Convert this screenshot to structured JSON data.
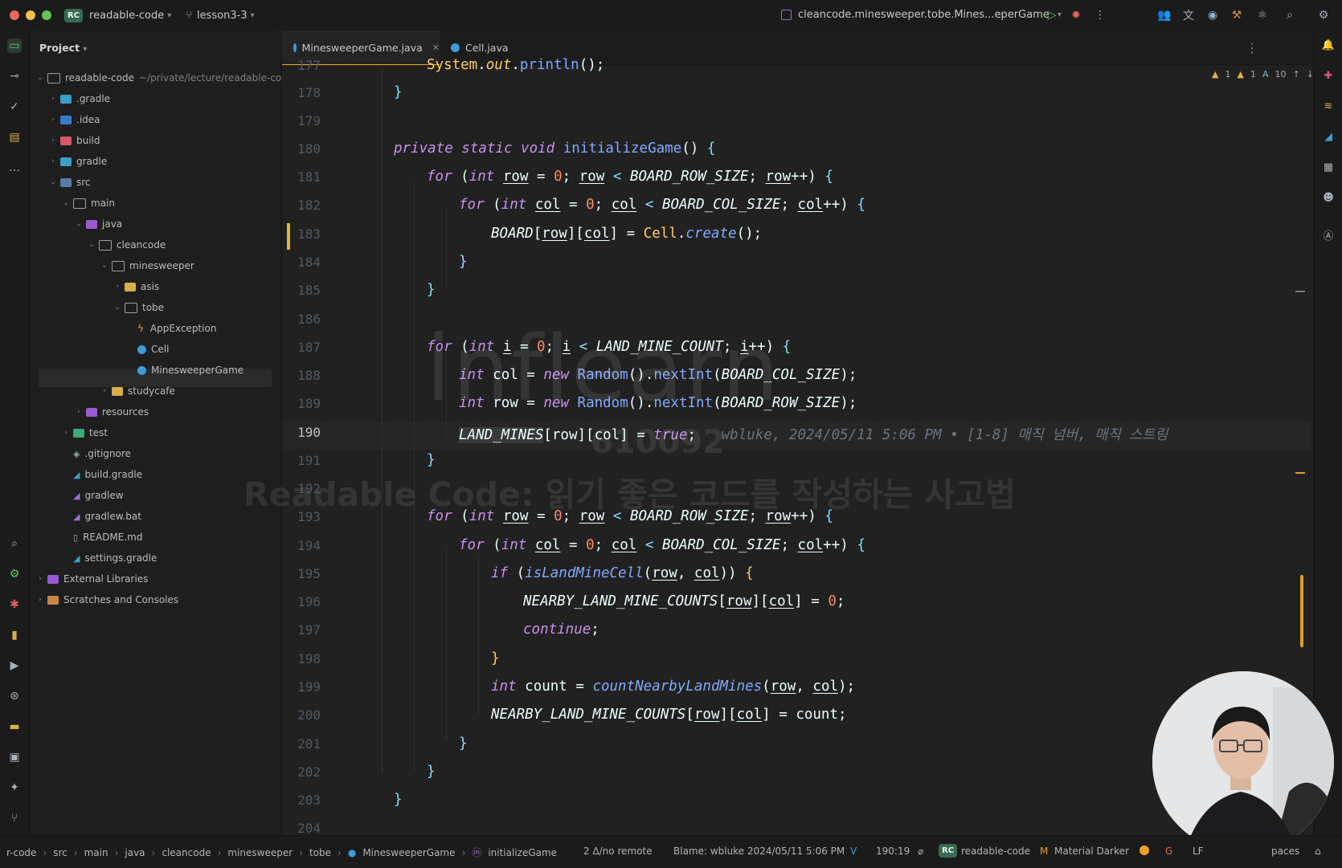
{
  "titlebar": {
    "project_badge": "RC",
    "project_name": "readable-code",
    "branch": "lesson3-3",
    "run_config": "cleancode.minesweeper.tobe.Mines...eperGame"
  },
  "project_panel": {
    "header": "Project",
    "tree": [
      {
        "label": "readable-code",
        "sub": "~/private/lecture/readable-co"
      },
      {
        "label": ".gradle"
      },
      {
        "label": ".idea"
      },
      {
        "label": "build"
      },
      {
        "label": "gradle"
      },
      {
        "label": "src"
      },
      {
        "label": "main"
      },
      {
        "label": "java"
      },
      {
        "label": "cleancode"
      },
      {
        "label": "minesweeper"
      },
      {
        "label": "asis"
      },
      {
        "label": "tobe"
      },
      {
        "label": "AppException"
      },
      {
        "label": "Cell"
      },
      {
        "label": "MinesweeperGame"
      },
      {
        "label": "studycafe"
      },
      {
        "label": "resources"
      },
      {
        "label": "test"
      },
      {
        "label": ".gitignore"
      },
      {
        "label": "build.gradle"
      },
      {
        "label": "gradlew"
      },
      {
        "label": "gradlew.bat"
      },
      {
        "label": "README.md"
      },
      {
        "label": "settings.gradle"
      },
      {
        "label": "External Libraries"
      },
      {
        "label": "Scratches and Consoles"
      }
    ]
  },
  "tabs": [
    {
      "label": "MinesweeperGame.java",
      "active": true
    },
    {
      "label": "Cell.java",
      "active": false
    }
  ],
  "inspections": {
    "warnings_a": "1",
    "warnings_b": "1",
    "typos": "10"
  },
  "editor": {
    "line_numbers": [
      "177",
      "178",
      "179",
      "180",
      "181",
      "182",
      "183",
      "184",
      "185",
      "186",
      "187",
      "188",
      "189",
      "190",
      "191",
      "192",
      "193",
      "194",
      "195",
      "196",
      "197",
      "198",
      "199",
      "200",
      "201",
      "202",
      "203",
      "204"
    ],
    "current_line": "190",
    "blame_inline": "wbluke, 2024/05/11 5:06 PM • [1-8] 매직 넘버, 매직 스트링",
    "top_partial": "System.out.println();"
  },
  "watermark": {
    "brand": "inflearn",
    "id": "610092",
    "course": "Readable Code: 읽기 좋은 코드를 작성하는 사고법"
  },
  "statusbar": {
    "breadcrumbs": [
      "r-code",
      "src",
      "main",
      "java",
      "cleancode",
      "minesweeper",
      "tobe",
      "MinesweeperGame",
      "initializeGame"
    ],
    "vcs": "2 Δ/no remote",
    "blame": "Blame: wbluke 2024/05/11 5:06 PM",
    "position": "190:19",
    "project_badge": "RC",
    "project": "readable-code",
    "theme": "Material Darker",
    "line_sep": "LF",
    "indent": "paces"
  },
  "colors": {
    "keyword": "#c792ea",
    "function": "#82aaff",
    "constant": "#ffcb6b",
    "number": "#f78c6c",
    "accent": "#f0a732"
  }
}
